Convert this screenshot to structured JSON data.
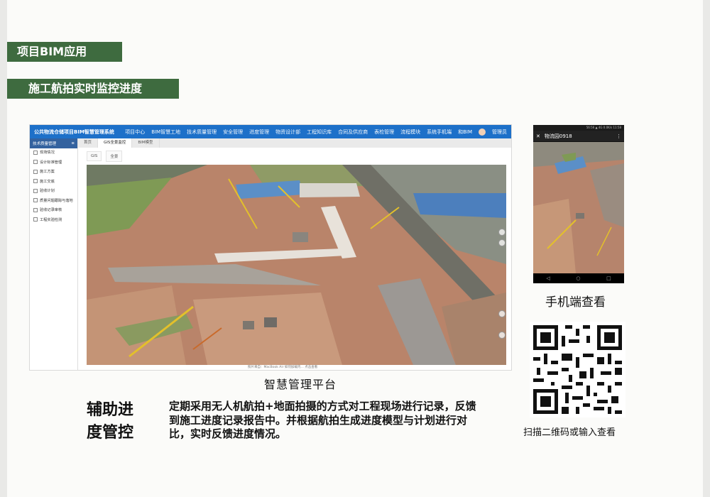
{
  "section_tags": {
    "project_bim": "项目BIM应用",
    "aerial_monitoring": "施工航拍实时监控进度"
  },
  "app": {
    "title": "公共物流仓储项目BIM智慧管理系统",
    "nav": [
      "项目中心",
      "BIM智慧工地",
      "技术质量管理",
      "安全管理",
      "进度管理",
      "物资设计部",
      "工程知识库",
      "合同及供应商",
      "表检管理",
      "流程模块",
      "系统"
    ],
    "nav_right": [
      "手机端",
      "和BIM",
      "管理员"
    ],
    "sidebar_title": "技术质量管理",
    "sidebar_items": [
      "现场情况",
      "设计标准管理",
      "施工方案",
      "施工交底",
      "验收计划",
      "质量问题跟踪与落地",
      "验收记录审核",
      "工程实验检测"
    ],
    "tabs": [
      "首页",
      "GIS全景监控",
      "BIM模型"
    ],
    "subtabs": [
      "GIS",
      "全景"
    ],
    "status_text": "照片来自：MacBook Air 如何加载内…  点击查看"
  },
  "captions": {
    "platform": "智慧管理平台",
    "mobile": "手机端查看",
    "qr": "扫描二维码或输入查看"
  },
  "phone": {
    "status": "56:56 ▲ 4G 0.0K/s 11:58",
    "title": "物流园0918"
  },
  "heading": "辅助进度管控",
  "description": "定期采用无人机航拍+地面拍摄的方式对工程现场进行记录，反馈到施工进度记录报告中。并根据航拍生成进度模型与计划进行对比，实时反馈进度情况。",
  "colors": {
    "tag_green": "#3e6b3f",
    "app_blue": "#1d70c9",
    "soil": "#b9846a"
  }
}
